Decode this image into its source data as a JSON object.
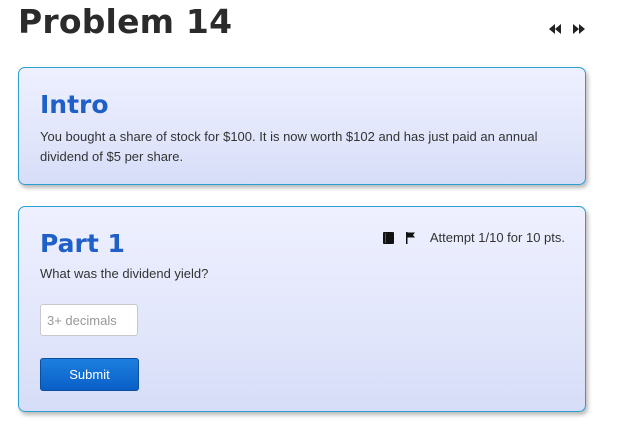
{
  "page": {
    "title": "Problem 14",
    "nav": {
      "prev_icon": "rewind-icon",
      "next_icon": "fast-forward-icon"
    }
  },
  "intro": {
    "heading": "Intro",
    "text": "You bought a share of stock for $100. It is now worth $102 and has just paid an annual dividend of $5 per share."
  },
  "part1": {
    "heading": "Part 1",
    "question": "What was the dividend yield?",
    "tools": {
      "book_icon": "book-icon",
      "flag_icon": "flag-icon"
    },
    "attempt": "Attempt 1/10 for 10 pts.",
    "answer": {
      "value": "",
      "placeholder": "3+ decimals"
    },
    "submit_label": "Submit"
  },
  "colors": {
    "heading_blue": "#1e5fc8",
    "card_border": "#2a9fd0",
    "button_blue": "#0a5fc6"
  }
}
